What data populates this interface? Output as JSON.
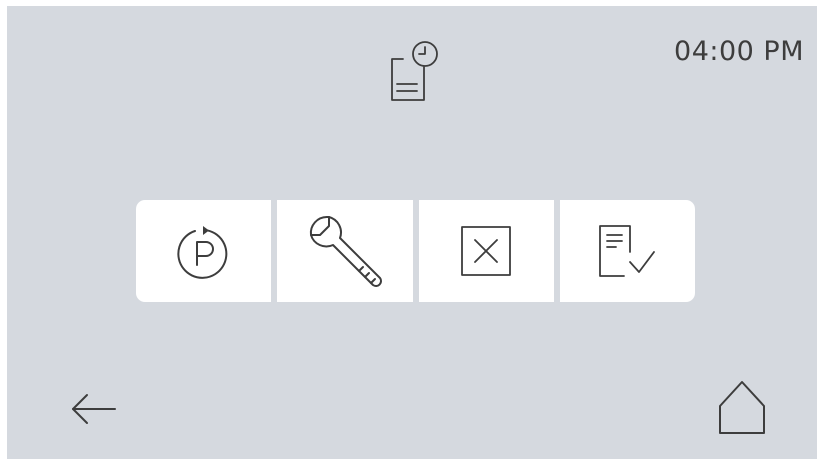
{
  "header": {
    "icon": "document-clock-icon",
    "time": "04:00 PM"
  },
  "actions": [
    {
      "id": "recycle-p",
      "icon": "circular-arrow-p-icon"
    },
    {
      "id": "service",
      "icon": "wrench-icon"
    },
    {
      "id": "cancel",
      "icon": "close-box-icon"
    },
    {
      "id": "checklist",
      "icon": "document-check-icon"
    }
  ],
  "footer": {
    "back_icon": "arrow-left-icon",
    "home_icon": "home-icon"
  },
  "colors": {
    "background": "#d5d9df",
    "tile": "#ffffff",
    "icon_stroke": "#3d3d3d"
  }
}
